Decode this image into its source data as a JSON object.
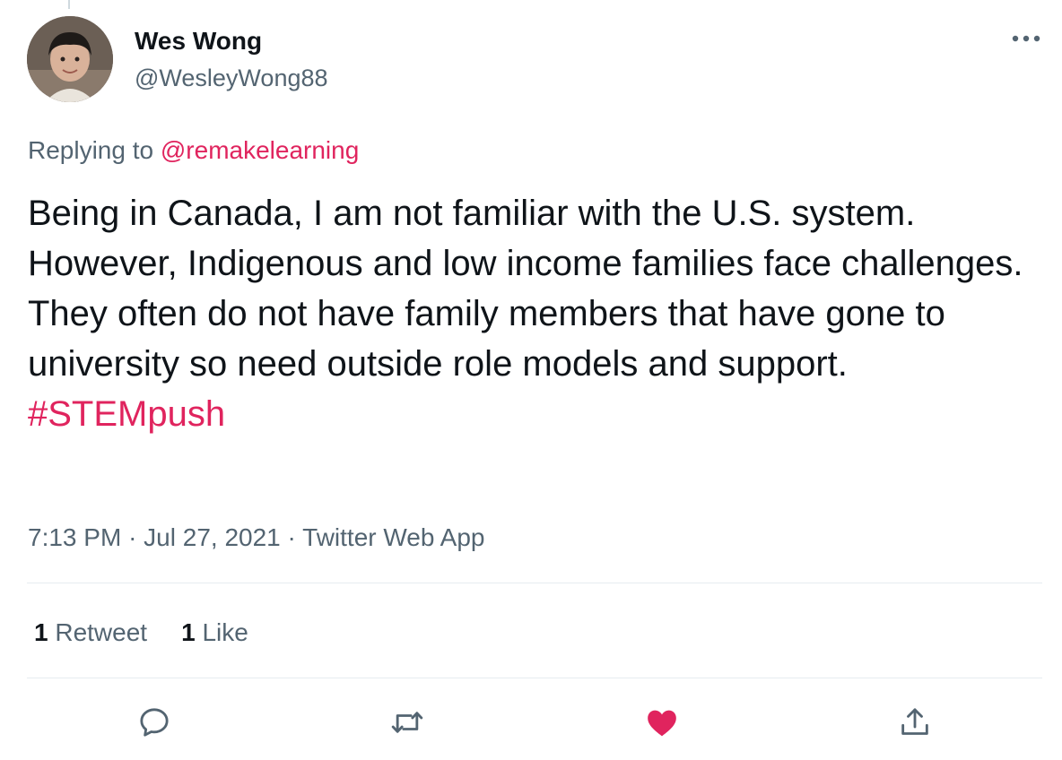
{
  "author": {
    "name": "Wes Wong",
    "handle": "@WesleyWong88"
  },
  "reply": {
    "prefix": "Replying to ",
    "mention": "@remakelearning"
  },
  "tweet": {
    "text": "Being in Canada, I am not familiar with the U.S. system. However, Indigenous and low income families face challenges.  They often do not have family members that have gone to university so need outside role models and support.",
    "hashtag": "#STEMpush"
  },
  "meta": {
    "time": "7:13 PM",
    "separator": "·",
    "date": "Jul 27, 2021",
    "source": "Twitter Web App"
  },
  "stats": {
    "retweets": "1",
    "retweets_label": "Retweet",
    "likes": "1",
    "likes_label": "Like"
  },
  "icons": {
    "more": "more-icon",
    "reply": "reply-icon",
    "retweet": "retweet-icon",
    "like": "heart-icon",
    "share": "share-icon"
  },
  "colors": {
    "accent": "#e0245e",
    "secondary_text": "#536471",
    "primary_text": "#0f1419",
    "divider": "#e6ecf0"
  }
}
